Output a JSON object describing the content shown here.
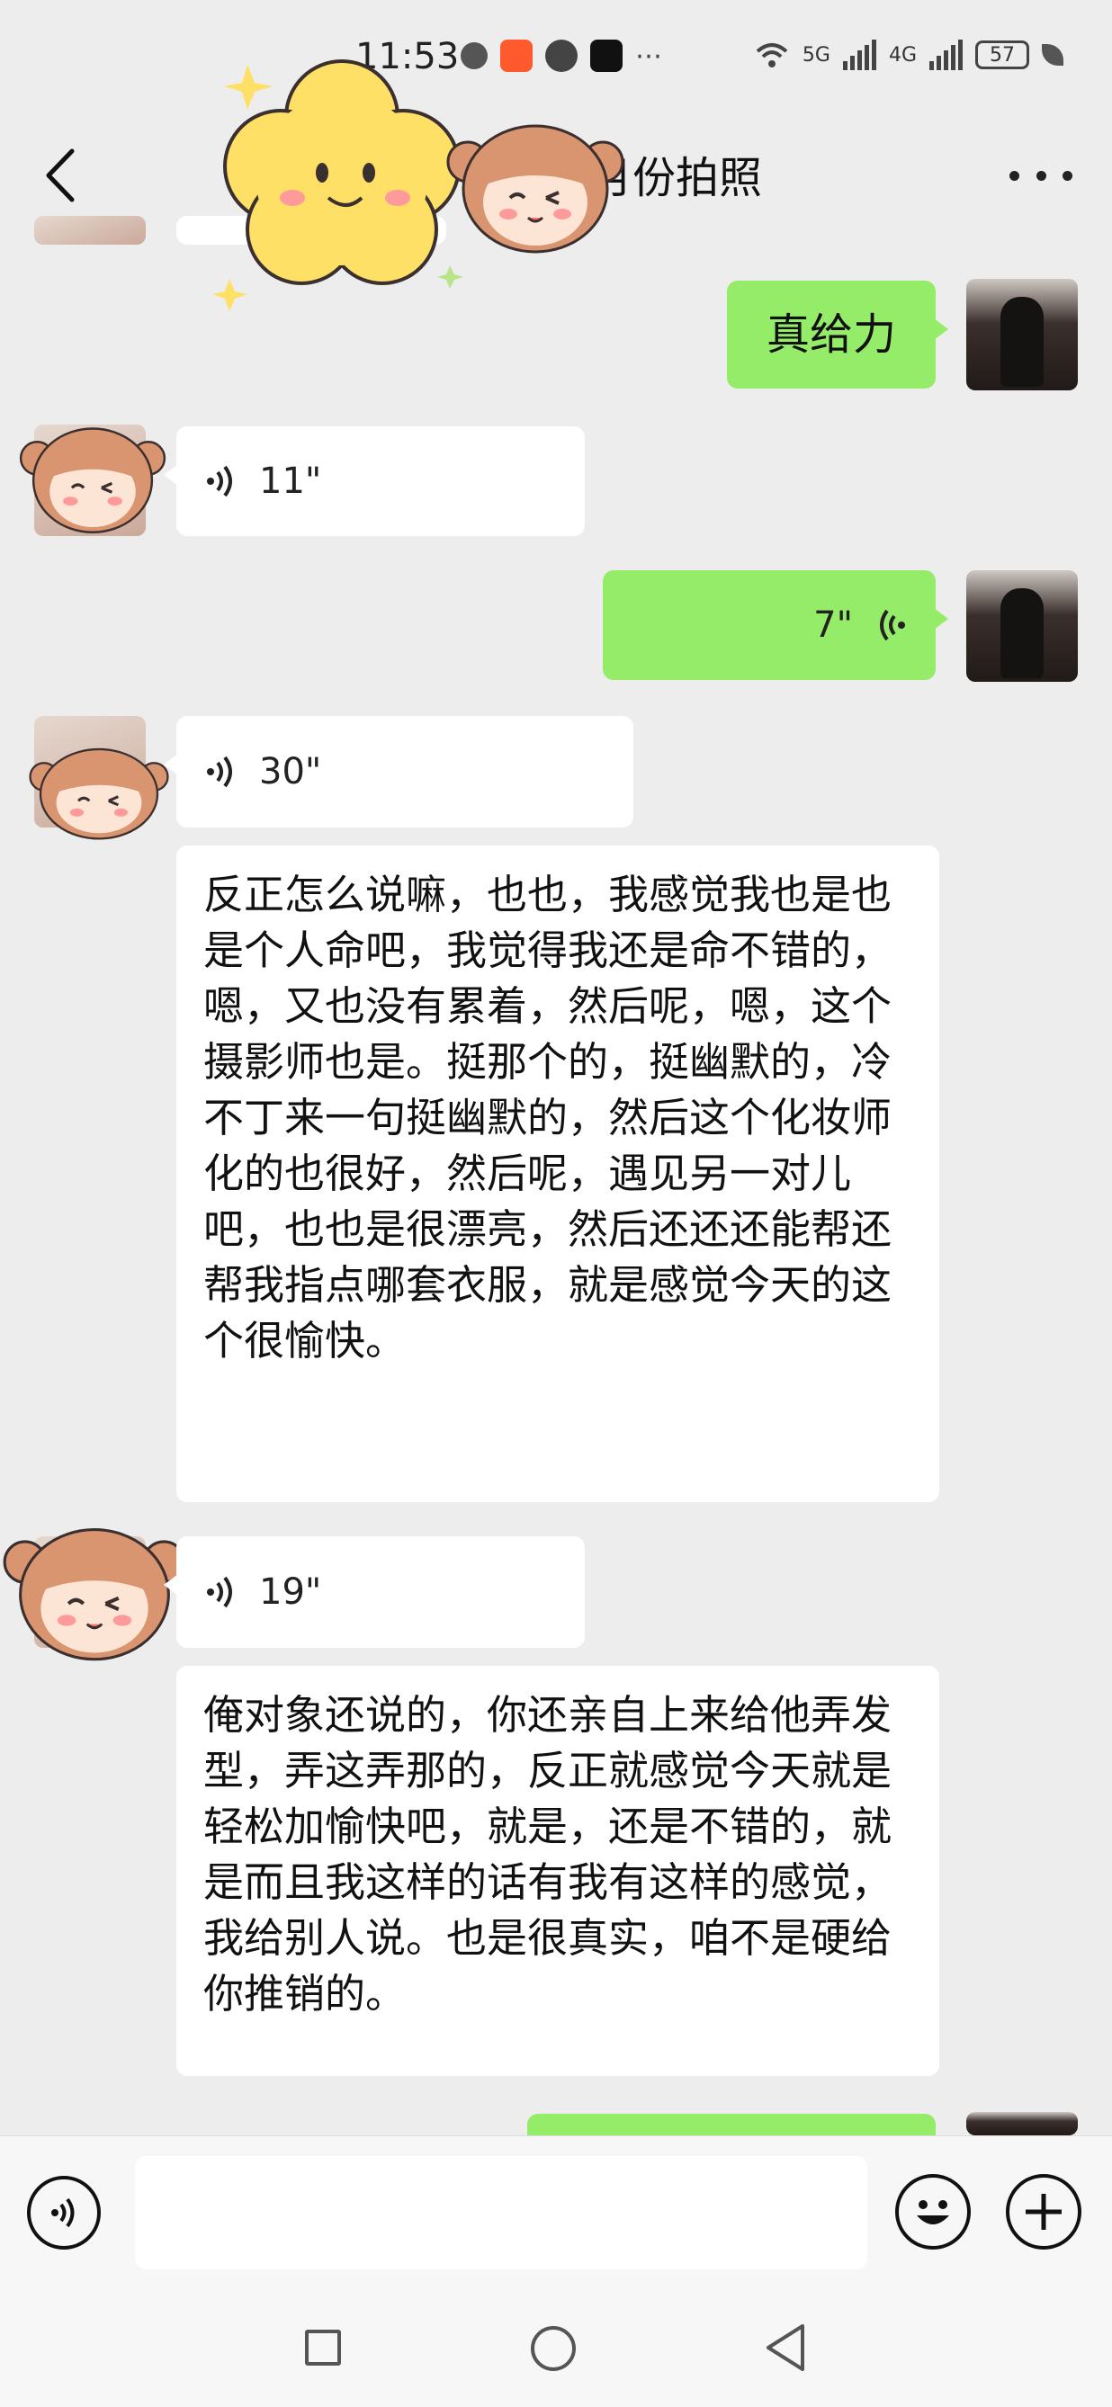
{
  "status_bar": {
    "time": "11:53",
    "network_5g": "5G",
    "network_4g": "4G",
    "battery": "57"
  },
  "header": {
    "title": "月份拍照"
  },
  "messages": [
    {
      "side": "right",
      "type": "text",
      "text": "真给力"
    },
    {
      "side": "left",
      "type": "voice",
      "duration": "11\""
    },
    {
      "side": "right",
      "type": "voice",
      "duration": "7\""
    },
    {
      "side": "left",
      "type": "voice",
      "duration": "30\"",
      "transcript": "反正怎么说嘛，也也，我感觉我也是也是个人命吧，我觉得我还是命不错的，嗯，又也没有累着，然后呢，嗯，这个摄影师也是。挺那个的，挺幽默的，冷不丁来一句挺幽默的，然后这个化妆师化的也很好，然后呢，遇见另一对儿吧，也也是很漂亮，然后还还还能帮还帮我指点哪套衣服，就是感觉今天的这个很愉快。"
    },
    {
      "side": "left",
      "type": "voice",
      "duration": "19\"",
      "transcript": "俺对象还说的，你还亲自上来给他弄发型，弄这弄那的，反正就感觉今天就是轻松加愉快吧，就是，还是不错的，就是而且我这样的话有我有这样的感觉，我给别人说。也是很真实，咱不是硬给你推销的。"
    }
  ],
  "colors": {
    "sent_bubble": "#95ec69",
    "received_bubble": "#ffffff",
    "background": "#ededed"
  },
  "icons": [
    "back-icon",
    "more-icon",
    "voice-input-icon",
    "emoji-icon",
    "plus-icon",
    "nav-recents-icon",
    "nav-home-icon",
    "nav-back-icon"
  ]
}
